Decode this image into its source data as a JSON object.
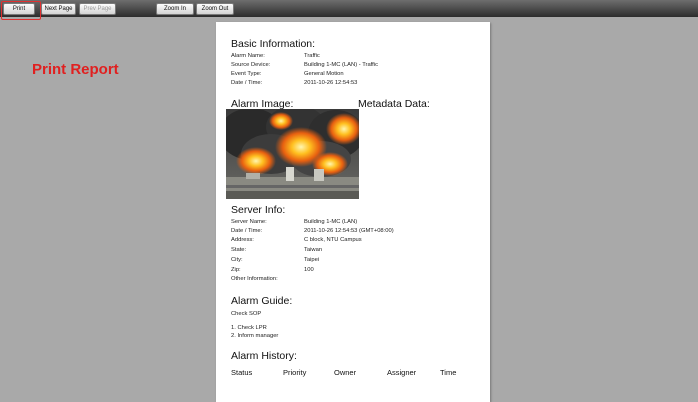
{
  "toolbar": {
    "print": "Print",
    "next_page": "Next Page",
    "prev_page": "Prev Page",
    "zoom_in": "Zoom In",
    "zoom_out": "Zoom Out"
  },
  "overlay_label": "Print Report",
  "report": {
    "basic": {
      "title": "Basic Information:",
      "rows": [
        {
          "label": "Alarm Name:",
          "value": "Traffic"
        },
        {
          "label": "Source Device:",
          "value": "Building 1-MC (LAN) - Traffic"
        },
        {
          "label": "Event Type:",
          "value": "General Motion"
        },
        {
          "label": "Date / Time:",
          "value": "2011-10-26 12:54:53"
        }
      ]
    },
    "alarm_image_title": "Alarm Image:",
    "metadata_title": "Metadata Data:",
    "server": {
      "title": "Server Info:",
      "rows": [
        {
          "label": "Server Name:",
          "value": "Building 1-MC (LAN)"
        },
        {
          "label": "Date / Time:",
          "value": "2011-10-26 12:54:53 (GMT+08:00)"
        },
        {
          "label": "Address:",
          "value": "C block, NTU Campus"
        },
        {
          "label": "State:",
          "value": "Taiwan"
        },
        {
          "label": "City:",
          "value": "Taipei"
        },
        {
          "label": "Zip:",
          "value": "100"
        },
        {
          "label": "Other Information:",
          "value": ""
        }
      ]
    },
    "guide": {
      "title": "Alarm Guide:",
      "sop": "Check SOP",
      "steps": [
        "1. Check LPR",
        "2. Inform manager"
      ]
    },
    "history": {
      "title": "Alarm History:",
      "columns": [
        "Status",
        "Priority",
        "Owner",
        "Assigner",
        "Time"
      ]
    }
  }
}
